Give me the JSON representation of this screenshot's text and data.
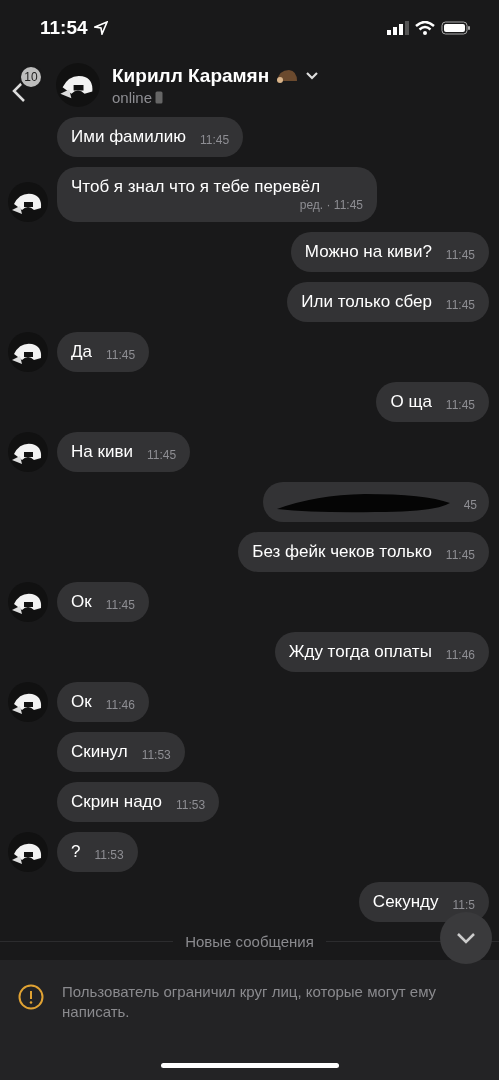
{
  "status_bar": {
    "time": "11:54"
  },
  "header": {
    "back_badge": "10",
    "name": "Кирилл Карамян",
    "status": "online"
  },
  "messages": [
    {
      "outgoing": false,
      "avatar": false,
      "kind": "text",
      "text": "Ими фамилию",
      "time": "11:45"
    },
    {
      "outgoing": false,
      "avatar": true,
      "kind": "text",
      "text": "Чтоб я знал что я тебе перевёл",
      "time": "ред. · 11:45"
    },
    {
      "outgoing": true,
      "avatar": false,
      "kind": "text",
      "text": "Можно на киви?",
      "time": "11:45"
    },
    {
      "outgoing": true,
      "avatar": false,
      "kind": "text",
      "text": "Или только сбер",
      "time": "11:45"
    },
    {
      "outgoing": false,
      "avatar": true,
      "kind": "text",
      "text": "Да",
      "time": "11:45"
    },
    {
      "outgoing": true,
      "avatar": false,
      "kind": "text",
      "text": "О ща",
      "time": "11:45"
    },
    {
      "outgoing": false,
      "avatar": true,
      "kind": "text",
      "text": "На киви",
      "time": "11:45"
    },
    {
      "outgoing": true,
      "avatar": false,
      "kind": "redacted",
      "time": "45"
    },
    {
      "outgoing": true,
      "avatar": false,
      "kind": "text",
      "text": "Без фейк чеков только",
      "time": "11:45"
    },
    {
      "outgoing": false,
      "avatar": true,
      "kind": "text",
      "text": "Ок",
      "time": "11:45"
    },
    {
      "outgoing": true,
      "avatar": false,
      "kind": "text",
      "text": "Жду тогда оплаты",
      "time": "11:46"
    },
    {
      "outgoing": false,
      "avatar": true,
      "kind": "text",
      "text": "Ок",
      "time": "11:46"
    },
    {
      "outgoing": false,
      "avatar": false,
      "kind": "text",
      "text": "Скинул",
      "time": "11:53"
    },
    {
      "outgoing": false,
      "avatar": false,
      "kind": "text",
      "text": "Скрин надо",
      "time": "11:53"
    },
    {
      "outgoing": false,
      "avatar": true,
      "kind": "text",
      "text": "?",
      "time": "11:53"
    },
    {
      "outgoing": true,
      "avatar": false,
      "kind": "text",
      "text": "Секунду",
      "time": "11:5"
    }
  ],
  "divider": "Новые сообщения",
  "notice": "Пользователь ограничил круг лиц, которые могут ему написать."
}
